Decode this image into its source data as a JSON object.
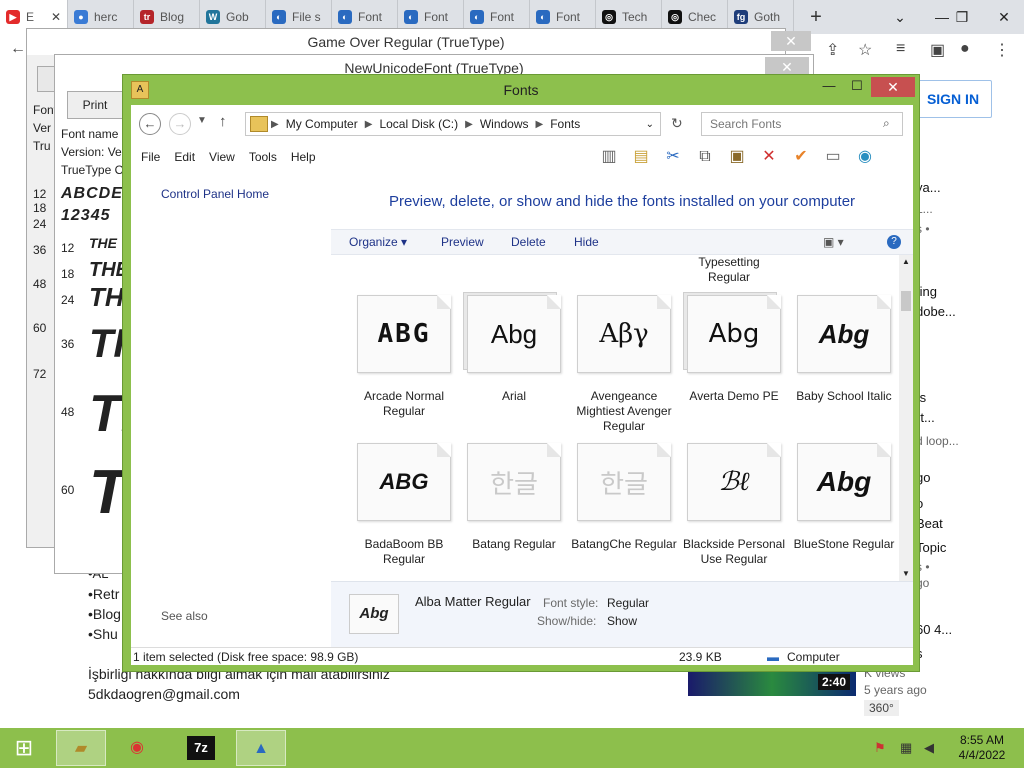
{
  "browser": {
    "tabs": [
      {
        "label": "E",
        "fav_color": "#e32b2b",
        "fav_glyph": "▶"
      },
      {
        "label": "herc",
        "fav_color": "#3a7bd5",
        "fav_glyph": "●"
      },
      {
        "label": "Blog",
        "fav_color": "#b5252a",
        "fav_glyph": "tr"
      },
      {
        "label": "Gob",
        "fav_color": "#21759b",
        "fav_glyph": "W"
      },
      {
        "label": "File s",
        "fav_color": "#2a6ac0",
        "fav_glyph": "◐"
      },
      {
        "label": "Font",
        "fav_color": "#2a6ac0",
        "fav_glyph": "◐"
      },
      {
        "label": "Font",
        "fav_color": "#2a6ac0",
        "fav_glyph": "◐"
      },
      {
        "label": "Font",
        "fav_color": "#2a6ac0",
        "fav_glyph": "◐"
      },
      {
        "label": "Font",
        "fav_color": "#2a6ac0",
        "fav_glyph": "◐"
      },
      {
        "label": "Tech",
        "fav_color": "#111111",
        "fav_glyph": "◎"
      },
      {
        "label": "Chec",
        "fav_color": "#111111",
        "fav_glyph": "◎"
      },
      {
        "label": "Goth",
        "fav_color": "#1f3d7a",
        "fav_glyph": "fg"
      }
    ]
  },
  "page": {
    "signin": "SIGN IN",
    "bullets": [
      "•Retr",
      "•Blog",
      "•Shu"
    ],
    "partial_line": "•AL",
    "contact_line": "İşbirliği hakkında bilgi almak için mail atabilirsiniz",
    "email": "5dkdaogren@gmail.com",
    "side_lines": [
      "ya...",
      "L...",
      "s •",
      "ting",
      "dobe...",
      "ts",
      "rt...",
      "d loop...",
      "go",
      "o",
      "Beat",
      "Topic",
      "s •",
      "go",
      "60 4...",
      "s"
    ],
    "video_duration": "2:40",
    "video_age": "5 years ago",
    "video_tag": "360°",
    "video_views_fragment": "K views"
  },
  "bg_windows": {
    "game_over_title": "Game Over Regular (TrueType)",
    "new_unicode_title": "NewUnicodeFont (TrueType)",
    "print_button": "Print",
    "font_name_label": "Font name",
    "version_label": "Version: Ve",
    "type_label": "TrueType O",
    "side_labels": [
      "Font",
      "Ver",
      "Tru"
    ],
    "sizes_a": [
      "12",
      "18",
      "24",
      "36",
      "48",
      "60",
      "72"
    ],
    "sizes_b": [
      "12",
      "18",
      "24",
      "36",
      "48",
      "60"
    ],
    "sample_abc": "ABCDE",
    "sample_num": "12345",
    "sample_word": "THE"
  },
  "fonts_window": {
    "title": "Fonts",
    "breadcrumbs": [
      "My Computer",
      "Local Disk (C:)",
      "Windows",
      "Fonts"
    ],
    "search_placeholder": "Search Fonts",
    "menu": [
      "File",
      "Edit",
      "View",
      "Tools",
      "Help"
    ],
    "left_links": {
      "home": "Control Panel Home",
      "see_also": "See also"
    },
    "heading": "Preview, delete, or show and hide the fonts installed on your computer",
    "commands": {
      "organize": "Organize",
      "preview": "Preview",
      "delete": "Delete",
      "hide": "Hide"
    },
    "above_row": "Typesetting Regular",
    "fonts": [
      {
        "name": "Arcade Normal Regular",
        "sample": "ABG",
        "faded": false,
        "stack": false
      },
      {
        "name": "Arial",
        "sample": "Abg",
        "faded": false,
        "stack": true
      },
      {
        "name": "Avengeance Mightiest Avenger Regular",
        "sample": "Αβγ",
        "faded": false,
        "stack": false
      },
      {
        "name": "Averta Demo PE",
        "sample": "Abg",
        "faded": false,
        "stack": true
      },
      {
        "name": "Baby School Italic",
        "sample": "Abg",
        "faded": false,
        "stack": false
      },
      {
        "name": "BadaBoom BB Regular",
        "sample": "ABG",
        "faded": false,
        "stack": false
      },
      {
        "name": "Batang Regular",
        "sample": "한글",
        "faded": true,
        "stack": false
      },
      {
        "name": "BatangChe Regular",
        "sample": "한글",
        "faded": true,
        "stack": false
      },
      {
        "name": "Blackside Personal Use Regular",
        "sample": "ℬℓ",
        "faded": false,
        "stack": false
      },
      {
        "name": "BlueStone Regular",
        "sample": "Abg",
        "faded": false,
        "stack": false
      }
    ],
    "details": {
      "icon_sample": "Abg",
      "name": "Alba Matter Regular",
      "style_label": "Font style:",
      "style_value": "Regular",
      "showhide_label": "Show/hide:",
      "showhide_value": "Show"
    },
    "status": {
      "selected": "1 item selected (Disk free space: 98.9 GB)",
      "size": "23.9 KB",
      "location": "Computer"
    }
  },
  "taskbar": {
    "time": "8:55 AM",
    "date": "4/4/2022",
    "apps": [
      "folder",
      "chrome",
      "7z",
      "font-viewer"
    ]
  }
}
